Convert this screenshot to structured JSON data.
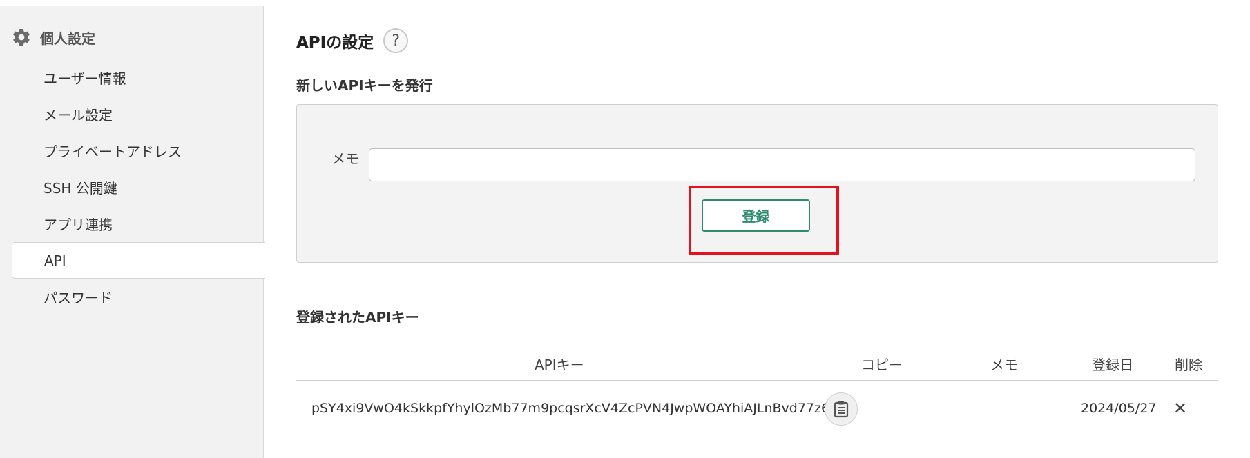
{
  "sidebar": {
    "title": "個人設定",
    "items": [
      {
        "label": "ユーザー情報"
      },
      {
        "label": "メール設定"
      },
      {
        "label": "プライベートアドレス"
      },
      {
        "label": "SSH 公開鍵"
      },
      {
        "label": "アプリ連携"
      },
      {
        "label": "API",
        "active": true
      },
      {
        "label": "パスワード"
      }
    ]
  },
  "main": {
    "title": "APIの設定",
    "help_symbol": "?",
    "new_key": {
      "heading": "新しいAPIキーを発行",
      "memo_label": "メモ",
      "memo_value": "",
      "register_label": "登録"
    },
    "keys": {
      "heading": "登録されたAPIキー",
      "columns": {
        "key": "APIキー",
        "copy": "コピー",
        "memo": "メモ",
        "date": "登録日",
        "delete": "削除"
      },
      "rows": [
        {
          "key": "pSY4xi9VwO4kSkkpfYhylOzMb77m9pcqsrXcV4ZcPVN4JwpWOAYhiAJLnBvd77z6",
          "memo": "",
          "date": "2024/05/27",
          "delete_symbol": "✕"
        }
      ]
    }
  },
  "colors": {
    "accent": "#2e8b6e",
    "highlight": "#e3131e",
    "sidebar_bg": "#f2f2f2"
  }
}
